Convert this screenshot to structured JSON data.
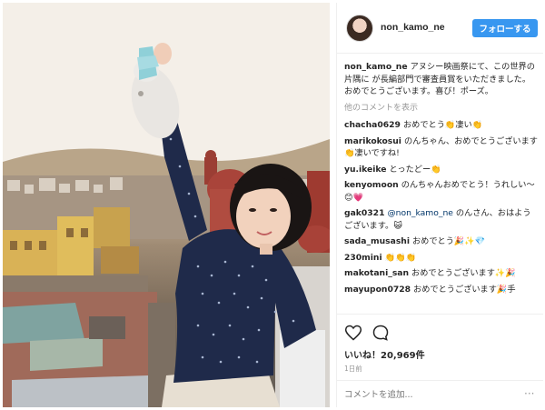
{
  "header": {
    "username": "non_kamo_ne",
    "follow_label": "フォローする"
  },
  "caption": {
    "username": "non_kamo_ne",
    "text": "アヌシー映画祭にて、この世界の片隅に が長編部門で審査員賞をいただきました。おめでとうございます。喜び！ポーズ。"
  },
  "view_more_label": "他のコメントを表示",
  "comments": [
    {
      "user": "chacha0629",
      "text": "おめでとう👏凄い👏"
    },
    {
      "user": "marikokosui",
      "text": "のんちゃん、おめでとうございます👏凄いですね!"
    },
    {
      "user": "yu.ikeike",
      "text": "とったどー👏"
    },
    {
      "user": "kenyomoon",
      "text": "のんちゃんおめでとう！うれしい～😊💗"
    },
    {
      "user": "gak0321",
      "mention": "@non_kamo_ne",
      "text": " のんさん、おはようございます。😺"
    },
    {
      "user": "sada_musashi",
      "text": "おめでとう🎉✨💎"
    },
    {
      "user": "230mini",
      "text": "👏👏👏"
    },
    {
      "user": "makotani_san",
      "text": "おめでとうございます✨🎉"
    },
    {
      "user": "mayupon0728",
      "text": "おめでとうございます🎉手"
    }
  ],
  "actions": {
    "heart_icon": "heart-icon",
    "comment_icon": "comment-icon",
    "likes_label": "いいね！20,969件",
    "time_label": "1日前",
    "add_comment_placeholder": "コメントを追加...",
    "more_icon_glyph": "···"
  },
  "colors": {
    "follow_button": "#3897f0",
    "mention": "#003569",
    "muted": "#999999"
  }
}
